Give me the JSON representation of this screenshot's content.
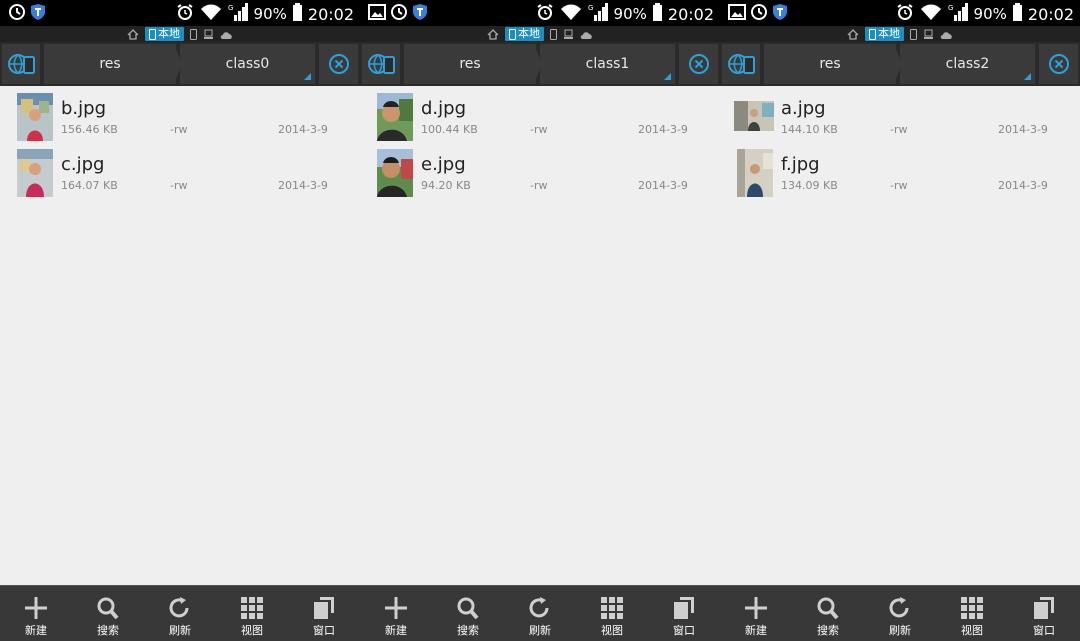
{
  "status": {
    "battery": "90%",
    "time": "20:02",
    "network": "G"
  },
  "location": {
    "local_label": "本地"
  },
  "colors": {
    "accent": "#2ea0d8",
    "toolbar_bg": "#2b2b2b",
    "button_bg": "#3a3a3a",
    "list_bg": "#efefef",
    "bottom_bg": "#383838"
  },
  "panels": [
    {
      "breadcrumb": [
        "res",
        "class0"
      ],
      "files": [
        {
          "name": "b.jpg",
          "size": "156.46 KB",
          "perm": "-rw",
          "date": "2014-3-9"
        },
        {
          "name": "c.jpg",
          "size": "164.07 KB",
          "perm": "-rw",
          "date": "2014-3-9"
        }
      ]
    },
    {
      "breadcrumb": [
        "res",
        "class1"
      ],
      "files": [
        {
          "name": "d.jpg",
          "size": "100.44 KB",
          "perm": "-rw",
          "date": "2014-3-9"
        },
        {
          "name": "e.jpg",
          "size": "94.20 KB",
          "perm": "-rw",
          "date": "2014-3-9"
        }
      ]
    },
    {
      "breadcrumb": [
        "res",
        "class2"
      ],
      "files": [
        {
          "name": "a.jpg",
          "size": "144.10 KB",
          "perm": "-rw",
          "date": "2014-3-9"
        },
        {
          "name": "f.jpg",
          "size": "134.09 KB",
          "perm": "-rw",
          "date": "2014-3-9"
        }
      ]
    }
  ],
  "bottom_bar": {
    "new_label": "新建",
    "search_label": "搜索",
    "refresh_label": "刷新",
    "view_label": "视图",
    "window_label": "窗口"
  }
}
